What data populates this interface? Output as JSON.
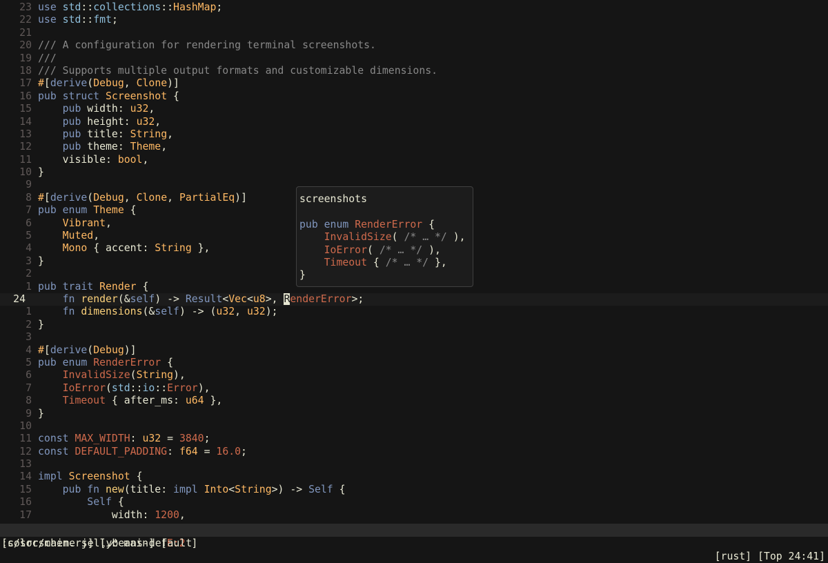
{
  "editor": {
    "lines": [
      {
        "num": "23",
        "code": "<span class=\"k\">use</span> <span class=\"m\">std</span>::<span class=\"m\">collections</span>::<span class=\"t\">HashMap</span>;"
      },
      {
        "num": "22",
        "code": "<span class=\"k\">use</span> <span class=\"m\">std</span>::<span class=\"m\">fmt</span>;"
      },
      {
        "num": "21",
        "code": ""
      },
      {
        "num": "20",
        "code": "<span class=\"c\">/// A configuration for rendering terminal screenshots.</span>"
      },
      {
        "num": "19",
        "code": "<span class=\"c\">///</span>"
      },
      {
        "num": "18",
        "code": "<span class=\"c\">/// Supports multiple output formats and customizable dimensions.</span>"
      },
      {
        "num": "17",
        "code": "<span class=\"t\">#</span>[<span class=\"k\">derive</span>(<span class=\"t\">Debug</span>, <span class=\"t\">Clone</span>)]"
      },
      {
        "num": "16",
        "code": "<span class=\"k\">pub struct</span> <span class=\"t\">Screenshot</span> {"
      },
      {
        "num": "15",
        "code": "    <span class=\"k\">pub</span> width: <span class=\"t\">u32</span>,"
      },
      {
        "num": "14",
        "code": "    <span class=\"k\">pub</span> height: <span class=\"t\">u32</span>,"
      },
      {
        "num": "13",
        "code": "    <span class=\"k\">pub</span> title: <span class=\"t\">String</span>,"
      },
      {
        "num": "12",
        "code": "    <span class=\"k\">pub</span> theme: <span class=\"t\">Theme</span>,"
      },
      {
        "num": "11",
        "code": "    visible: <span class=\"t\">bool</span>,"
      },
      {
        "num": "10",
        "code": "}"
      },
      {
        "num": "9",
        "code": ""
      },
      {
        "num": "8",
        "code": "<span class=\"t\">#</span>[<span class=\"k\">derive</span>(<span class=\"t\">Debug</span>, <span class=\"t\">Clone</span>, <span class=\"t\">PartialEq</span>)]"
      },
      {
        "num": "7",
        "code": "<span class=\"k\">pub enum</span> <span class=\"t\">Theme</span> {"
      },
      {
        "num": "6",
        "code": "    <span class=\"v\">Vibrant</span>,"
      },
      {
        "num": "5",
        "code": "    <span class=\"v\">Muted</span>,"
      },
      {
        "num": "4",
        "code": "    <span class=\"v\">Mono</span> { accent: <span class=\"t\">String</span> },"
      },
      {
        "num": "3",
        "code": "}"
      },
      {
        "num": "2",
        "code": ""
      },
      {
        "num": "1",
        "code": "<span class=\"k\">pub trait</span> <span class=\"t\">Render</span> {"
      },
      {
        "num": "24",
        "current": true,
        "code": "    <span class=\"k\">fn</span> <span class=\"f\">render</span>(&amp;<span class=\"k\">self</span>) -&gt; <span class=\"k\">Result</span>&lt;<span class=\"t\">Vec</span>&lt;<span class=\"t\">u8</span>&gt;, <span class=\"cursor\">R</span><span class=\"n\">enderError</span>&gt;;"
      },
      {
        "num": "1",
        "code": "    <span class=\"k\">fn</span> <span class=\"f\">dimensions</span>(&amp;<span class=\"k\">self</span>) -&gt; (<span class=\"t\">u32</span>, <span class=\"t\">u32</span>);"
      },
      {
        "num": "2",
        "code": "}"
      },
      {
        "num": "3",
        "code": ""
      },
      {
        "num": "4",
        "code": "<span class=\"t\">#</span>[<span class=\"k\">derive</span>(<span class=\"t\">Debug</span>)]"
      },
      {
        "num": "5",
        "code": "<span class=\"k\">pub enum</span> <span class=\"n\">RenderError</span> {"
      },
      {
        "num": "6",
        "code": "    <span class=\"n\">InvalidSize</span>(<span class=\"t\">String</span>),"
      },
      {
        "num": "7",
        "code": "    <span class=\"n\">IoError</span>(<span class=\"m\">std</span>::<span class=\"m\">io</span>::<span class=\"n\">Error</span>),"
      },
      {
        "num": "8",
        "code": "    <span class=\"n\">Timeout</span> { after_ms: <span class=\"t\">u64</span> },"
      },
      {
        "num": "9",
        "code": "}"
      },
      {
        "num": "10",
        "code": ""
      },
      {
        "num": "11",
        "code": "<span class=\"k\">const</span> <span class=\"n\">MAX_WIDTH</span>: <span class=\"t\">u32</span> = <span class=\"n\">3840</span>;"
      },
      {
        "num": "12",
        "code": "<span class=\"k\">const</span> <span class=\"n\">DEFAULT_PADDING</span>: <span class=\"t\">f64</span> = <span class=\"n\">16.0</span>;"
      },
      {
        "num": "13",
        "code": ""
      },
      {
        "num": "14",
        "code": "<span class=\"k\">impl</span> <span class=\"t\">Screenshot</span> {"
      },
      {
        "num": "15",
        "code": "    <span class=\"k\">pub fn</span> <span class=\"f\">new</span>(title: <span class=\"k\">impl</span> <span class=\"t\">Into</span>&lt;<span class=\"t\">String</span>&gt;) -&gt; <span class=\"k\">Self</span> {"
      },
      {
        "num": "16",
        "code": "        <span class=\"k\">Self</span> {"
      },
      {
        "num": "17",
        "code": "            width: <span class=\"n\">1200</span>,"
      }
    ]
  },
  "hover": {
    "lines": [
      "screenshots",
      "",
      "<span class=\"k\">pub enum</span> <span class=\"n\">RenderError</span> {",
      "    <span class=\"n\">InvalidSize</span>( <span class=\"c\">/* … */</span> ),",
      "    <span class=\"n\">IoError</span>( <span class=\"c\">/* … */</span> ),",
      "    <span class=\"n\">Timeout</span> { <span class=\"c\">/* … */</span> },",
      "}"
    ]
  },
  "statusline": {
    "file": "[s/src/main.rs]",
    "branch": "[⎇ main]",
    "errors_open": "[",
    "errors": "E:2",
    "errors_close": " ]",
    "filetype": "[rust]",
    "position": "[Top 24:41]"
  },
  "cmdline": {
    "text": ":colorscheme jellybeans-default"
  },
  "colors": {
    "background": "#151515",
    "keyword": "#8197bf",
    "type": "#ffb964",
    "function": "#fad07a",
    "constant": "#cf6a4c",
    "comment": "#888888"
  }
}
